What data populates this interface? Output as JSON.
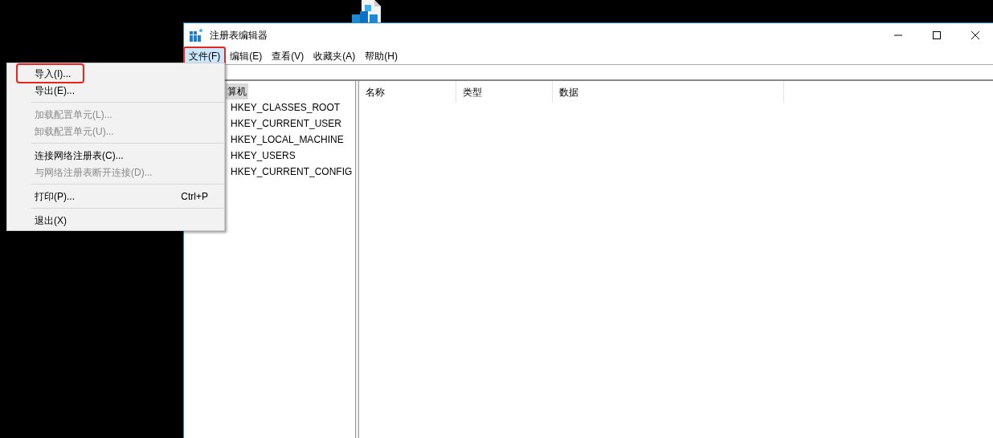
{
  "window": {
    "title": "注册表编辑器"
  },
  "menu_bar": [
    {
      "label": "文件(F)",
      "selected": true,
      "outlined": true
    },
    {
      "label": "编辑(E)",
      "selected": false,
      "outlined": false
    },
    {
      "label": "查看(V)",
      "selected": false,
      "outlined": false
    },
    {
      "label": "收藏夹(A)",
      "selected": false,
      "outlined": false
    },
    {
      "label": "帮助(H)",
      "selected": false,
      "outlined": false
    }
  ],
  "tree": {
    "label": "算机",
    "selected": true,
    "children": [
      {
        "label": "HKEY_CLASSES_ROOT"
      },
      {
        "label": "HKEY_CURRENT_USER"
      },
      {
        "label": "HKEY_LOCAL_MACHINE"
      },
      {
        "label": "HKEY_USERS"
      },
      {
        "label": "HKEY_CURRENT_CONFIG"
      }
    ]
  },
  "list": {
    "columns": [
      "名称",
      "类型",
      "数据"
    ]
  },
  "file_menu": [
    {
      "kind": "item",
      "label": "导入(I)...",
      "disabled": false,
      "outlined": true
    },
    {
      "kind": "item",
      "label": "导出(E)...",
      "disabled": false,
      "outlined": false
    },
    {
      "kind": "separator"
    },
    {
      "kind": "item",
      "label": "加载配置单元(L)...",
      "disabled": true,
      "outlined": false
    },
    {
      "kind": "item",
      "label": "卸载配置单元(U)...",
      "disabled": true,
      "outlined": false
    },
    {
      "kind": "separator"
    },
    {
      "kind": "item",
      "label": "连接网络注册表(C)...",
      "disabled": false,
      "outlined": false
    },
    {
      "kind": "item",
      "label": "与网络注册表断开连接(D)...",
      "disabled": true,
      "outlined": false
    },
    {
      "kind": "separator"
    },
    {
      "kind": "item",
      "label": "打印(P)...",
      "shortcut": "Ctrl+P",
      "disabled": false,
      "outlined": false
    },
    {
      "kind": "separator"
    },
    {
      "kind": "item",
      "label": "退出(X)",
      "disabled": false,
      "outlined": false
    }
  ]
}
